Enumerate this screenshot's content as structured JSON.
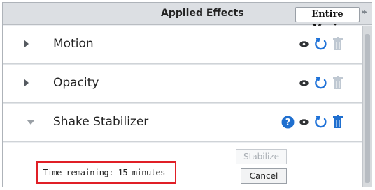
{
  "header": {
    "title": "Applied Effects",
    "scope_button": "Entire Movie",
    "menu_icon": "double-chevron-right-icon"
  },
  "effects": [
    {
      "name": "Motion",
      "expanded": false,
      "icons": [
        "eye-icon",
        "reset-icon",
        "trash-icon"
      ]
    },
    {
      "name": "Opacity",
      "expanded": false,
      "icons": [
        "eye-icon",
        "reset-icon",
        "trash-icon"
      ]
    },
    {
      "name": "Shake Stabilizer",
      "expanded": true,
      "icons": [
        "help-icon",
        "eye-icon",
        "reset-icon",
        "trash-icon"
      ]
    }
  ],
  "stabilizer": {
    "stabilize_label": "Stabilize",
    "cancel_label": "Cancel",
    "time_remaining": "Time remaining: 15 minutes"
  },
  "colors": {
    "accent_blue": "#1f72d8",
    "help_blue": "#1f6fcf",
    "highlight_red": "#e01f26",
    "disabled_trash": "#bfc8d2"
  }
}
